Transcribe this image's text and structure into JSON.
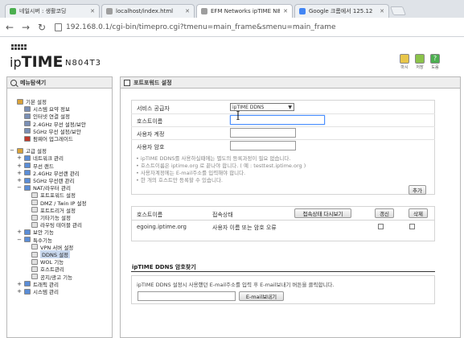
{
  "browser": {
    "tabs": [
      {
        "title": "네일시버 : 생활코딩",
        "favicon_color": "#4caf50",
        "active": false
      },
      {
        "title": "localhost/index.html",
        "favicon_color": "#9e9e9e",
        "active": false
      },
      {
        "title": "EFM Networks ipTIME N8",
        "favicon_color": "#9e9e9e",
        "active": true
      },
      {
        "title": "Google 크롬에서 125.12",
        "favicon_color": "#4285f4",
        "active": false
      }
    ],
    "url": "192.168.0.1/cgi-bin/timepro.cgi?tmenu=main_frame&smenu=main_frame"
  },
  "header": {
    "logo_prefix": "ip",
    "logo_brand": "TIME",
    "model": "N804T3",
    "icons": [
      {
        "name": "doc-icon",
        "label": "마시",
        "color": "#e8c64a"
      },
      {
        "name": "page-icon",
        "label": "저장",
        "color": "#8bc34a"
      },
      {
        "name": "help-icon",
        "label": "도움",
        "color": "#4caf50"
      }
    ]
  },
  "sidebar": {
    "title": "메뉴탐색기",
    "items": [
      {
        "label": "기본 설정",
        "level": 0,
        "toggle": "",
        "icon_color": "#d9a23a"
      },
      {
        "label": "시스템 요약 정보",
        "level": 1,
        "toggle": "",
        "icon_color": "#7a8fb5"
      },
      {
        "label": "인터넷 연결 설정",
        "level": 1,
        "toggle": "",
        "icon_color": "#7a8fb5"
      },
      {
        "label": "2.4GHz 무선 설정/보안",
        "level": 1,
        "toggle": "",
        "icon_color": "#7a8fb5"
      },
      {
        "label": "5GHz 무선 설정/보안",
        "level": 1,
        "toggle": "",
        "icon_color": "#7a8fb5"
      },
      {
        "label": "펌웨어 업그레이드",
        "level": 1,
        "toggle": "",
        "icon_color": "#c0392b"
      },
      {
        "label": "고급 설정",
        "level": 0,
        "toggle": "−",
        "icon_color": "#d9a23a"
      },
      {
        "label": "네트워크 관리",
        "level": 1,
        "toggle": "+",
        "icon_color": "#5b8dd6"
      },
      {
        "label": "무선 랜드",
        "level": 1,
        "toggle": "+",
        "icon_color": "#5b8dd6"
      },
      {
        "label": "2.4GHz 무선랜 관리",
        "level": 1,
        "toggle": "+",
        "icon_color": "#5b8dd6"
      },
      {
        "label": "5GHz 무선랜 관리",
        "level": 1,
        "toggle": "+",
        "icon_color": "#5b8dd6"
      },
      {
        "label": "NAT/라우터 관리",
        "level": 1,
        "toggle": "−",
        "icon_color": "#5b8dd6"
      },
      {
        "label": "포트포워드 설정",
        "level": 2,
        "toggle": "",
        "icon_color": "#e0e0e0"
      },
      {
        "label": "DMZ / Twin IP 설정",
        "level": 2,
        "toggle": "",
        "icon_color": "#e0e0e0"
      },
      {
        "label": "포트트리거 설정",
        "level": 2,
        "toggle": "",
        "icon_color": "#e0e0e0"
      },
      {
        "label": "기타기능 설정",
        "level": 2,
        "toggle": "",
        "icon_color": "#e0e0e0"
      },
      {
        "label": "라우팅 테이블 관리",
        "level": 2,
        "toggle": "",
        "icon_color": "#e0e0e0"
      },
      {
        "label": "보안 기능",
        "level": 1,
        "toggle": "+",
        "icon_color": "#5b8dd6"
      },
      {
        "label": "특수기능",
        "level": 1,
        "toggle": "−",
        "icon_color": "#5b8dd6"
      },
      {
        "label": "VPN 서버 설정",
        "level": 2,
        "toggle": "",
        "icon_color": "#e0e0e0"
      },
      {
        "label": "DDNS 설정",
        "level": 2,
        "toggle": "",
        "icon_color": "#e0e0e0",
        "selected": true
      },
      {
        "label": "WOL 기능",
        "level": 2,
        "toggle": "",
        "icon_color": "#e0e0e0"
      },
      {
        "label": "호스트관리",
        "level": 2,
        "toggle": "",
        "icon_color": "#e0e0e0"
      },
      {
        "label": "공지/광고 기능",
        "level": 2,
        "toggle": "",
        "icon_color": "#e0e0e0"
      },
      {
        "label": "트래픽 관리",
        "level": 1,
        "toggle": "+",
        "icon_color": "#5b8dd6"
      },
      {
        "label": "시스템 관리",
        "level": 1,
        "toggle": "+",
        "icon_color": "#5b8dd6"
      }
    ]
  },
  "main": {
    "title": "포트포워드 설정",
    "form": {
      "provider_label": "서비스 공급자",
      "provider_value": "ipTIME DDNS",
      "hostname_label": "호스트이름",
      "hostname_value": "",
      "user_label": "사용자 계정",
      "user_value": "",
      "password_label": "사용자 암호",
      "password_value": "",
      "notes": [
        "• ipTIME DDNS를 사용하실때에는 별도의 등록과정이 필요 없습니다.",
        "• 호스트이름은 iptime.org 로 끝나야 합니다. ( 예 : testtest.iptime.org )",
        "• 사용자계정에는 E-mail주소를 입력해야 합니다.",
        "• 한 개의 호스트만 등록할 수 있습니다."
      ],
      "add_button": "추가"
    },
    "table": {
      "headers": {
        "host": "호스트이름",
        "status": "접속상태",
        "reconnect": "접속상태 다시보기",
        "refresh": "갱신",
        "delete": "삭제"
      },
      "rows": [
        {
          "host": "egoing.iptime.org",
          "status": "사용자 이름 또는 암호 오류"
        }
      ]
    },
    "find": {
      "title": "ipTIME DDNS 암호찾기",
      "description": "ipTIME DDNS 설정시 사용했던 E-mail주소를 입력 후 E-mail보내기 버튼을 클릭합니다.",
      "email_value": "",
      "send_button": "E-mail보내기"
    }
  }
}
